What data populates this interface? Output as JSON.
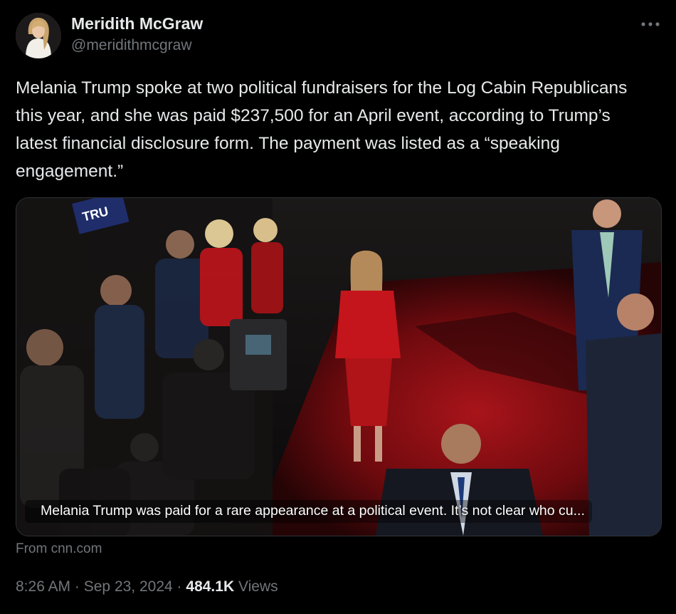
{
  "author": {
    "display_name": "Meridith McGraw",
    "handle": "@meridithmcgraw",
    "avatar_icon": "profile-photo"
  },
  "more_icon": "ellipsis-icon",
  "tweet": {
    "text": "Melania Trump spoke at two political fundraisers for the Log Cabin Republicans this year, and she was paid $237,500 for an April event, according to Trump’s latest financial disclosure form. The payment was listed as a “speaking engagement.”"
  },
  "card": {
    "caption": "Melania Trump was paid for a rare appearance at a political event. It’s not clear who cu...",
    "sign_text": "TRU",
    "source": "From cnn.com"
  },
  "meta": {
    "time": "8:26 AM",
    "separator": "·",
    "date": "Sep 23, 2024",
    "views_count": "484.1K",
    "views_label": "Views"
  },
  "colors": {
    "background": "#000000",
    "primary_text": "#e7e9ea",
    "secondary_text": "#71767b",
    "border": "#2f3336",
    "red_carpet": "#8e0b10",
    "red_dress": "#c4151c"
  }
}
